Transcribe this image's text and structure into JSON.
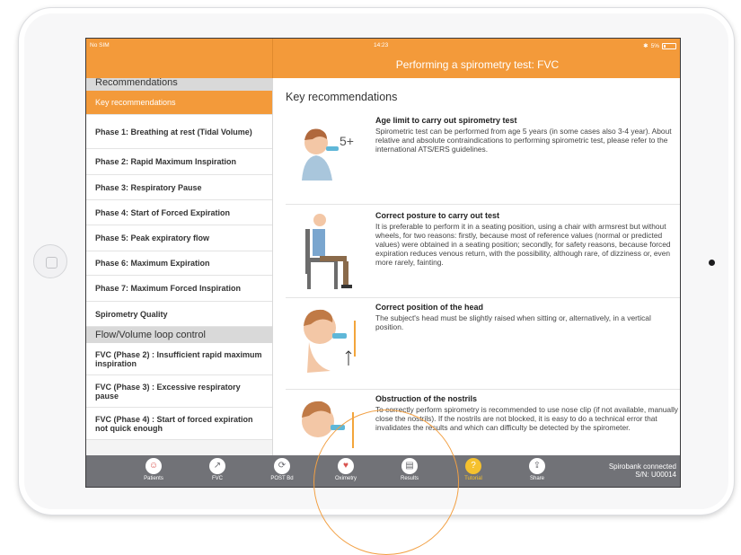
{
  "status_bar": {
    "carrier": "No SIM",
    "time": "14:23",
    "battery": "5%"
  },
  "header": {
    "title": "Performing a spirometry test: FVC"
  },
  "sidebar": {
    "section1": "Recommendations",
    "items1": [
      "Key recommendations",
      "Phase 1: Breathing at rest (Tidal Volume)",
      "Phase 2: Rapid Maximum Inspiration",
      "Phase 3: Respiratory Pause",
      "Phase 4: Start of Forced Expiration",
      "Phase 5: Peak expiratory flow",
      "Phase 6: Maximum Expiration",
      "Phase 7: Maximum Forced Inspiration",
      "Spirometry Quality"
    ],
    "section2": "Flow/Volume loop control",
    "items2": [
      "FVC (Phase 2) : Insufficient rapid maximum inspiration",
      "FVC (Phase 3) : Excessive respiratory pause",
      "FVC (Phase 4) : Start of forced expiration not quick enough"
    ]
  },
  "content": {
    "heading": "Key recommendations",
    "blocks": [
      {
        "title": "Age limit to carry out spirometry test",
        "badge": "5+",
        "body": "Spirometric test can be performed from age 5 years (in some cases also 3-4 year). About relative and absolute contraindications to performing spirometric test, please refer to the international ATS/ERS guidelines."
      },
      {
        "title": "Correct posture to carry out test",
        "body": "It is preferable to perform it in a seating position, using a chair with armsrest but without wheels, for two reasons:  firstly, because most of reference values (normal or predicted values) were obtained in a seating position; secondly, for safety reasons, because forced expiration reduces venous return, with the possibility, although rare, of dizziness or, even more rarely, fainting."
      },
      {
        "title": "Correct position of the head",
        "body": "The subject's head must be slightly raised when sitting or, alternatively, in a vertical position."
      },
      {
        "title": "Obstruction of the nostrils",
        "body": "To correctly perform spirometry is recommended to use nose clip (if not available, manually close the nostrils). If the nostrils are not blocked, it is easy to do a technical error that invalidates the results and which can difficulty be detected by the spirometer."
      }
    ]
  },
  "tabbar": {
    "tabs": [
      "Patients",
      "FVC",
      "POST Bd",
      "Oximetry",
      "Results",
      "Tutorial",
      "Share"
    ],
    "icons": [
      "patients-icon",
      "fvc-icon",
      "post-bd-icon",
      "oximetry-icon",
      "results-icon",
      "tutorial-icon",
      "share-icon"
    ],
    "active_tab": "Tutorial",
    "connection_line1": "Spirobank connected",
    "connection_line2": "S/N: U00014"
  },
  "colors": {
    "accent": "#f39a3a",
    "tabbar": "#717277",
    "active_tab": "#f5c12e"
  }
}
